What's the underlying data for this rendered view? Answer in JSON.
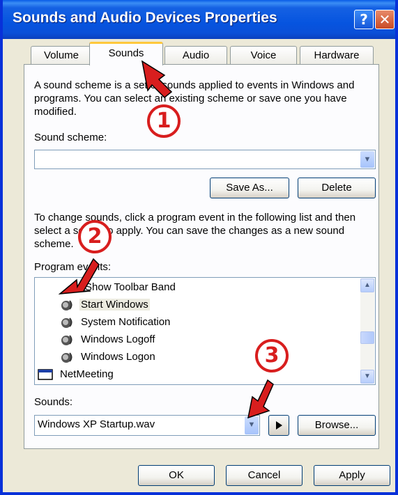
{
  "window": {
    "title": "Sounds and Audio Devices Properties",
    "help_glyph": "?",
    "close_glyph": "✕"
  },
  "tabs": [
    {
      "label": "Volume",
      "active": false
    },
    {
      "label": "Sounds",
      "active": true
    },
    {
      "label": "Audio",
      "active": false
    },
    {
      "label": "Voice",
      "active": false
    },
    {
      "label": "Hardware",
      "active": false
    }
  ],
  "sounds_tab": {
    "scheme_description": "A sound scheme is a set of sounds applied to events in Windows and programs. You can select an existing scheme or save one you have modified.",
    "scheme_label": "Sound scheme:",
    "scheme_value": "",
    "save_as_label": "Save As...",
    "delete_label": "Delete",
    "events_description": "To change sounds, click a program event in the following list and then select a sound to apply. You can save the changes as a new sound scheme.",
    "events_label": "Program events:",
    "events": [
      {
        "label": "Show Toolbar Band",
        "icon": "none",
        "selected": false
      },
      {
        "label": "Start Windows",
        "icon": "speaker-icon",
        "selected": true
      },
      {
        "label": "System Notification",
        "icon": "speaker-icon",
        "selected": false
      },
      {
        "label": "Windows Logoff",
        "icon": "speaker-icon",
        "selected": false
      },
      {
        "label": "Windows Logon",
        "icon": "speaker-icon",
        "selected": false
      },
      {
        "label": "NetMeeting",
        "icon": "window-icon",
        "selected": false
      }
    ],
    "sounds_label": "Sounds:",
    "sound_value": "Windows XP Startup.wav",
    "browse_label": "Browse..."
  },
  "footer": {
    "ok_label": "OK",
    "cancel_label": "Cancel",
    "apply_label": "Apply"
  },
  "annotations": [
    {
      "number": "1"
    },
    {
      "number": "2"
    },
    {
      "number": "3"
    }
  ],
  "colors": {
    "titlebar": "#0654df",
    "annotation_red": "#d81e1e",
    "active_tab_accent": "#ffc83c"
  }
}
